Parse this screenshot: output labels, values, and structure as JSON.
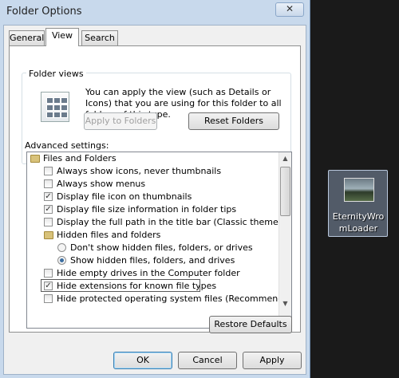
{
  "window": {
    "title": "Folder Options",
    "close_glyph": "✕"
  },
  "tabs": [
    {
      "label": "General"
    },
    {
      "label": "View"
    },
    {
      "label": "Search"
    }
  ],
  "folder_views": {
    "group_title": "Folder views",
    "icon": "folder-view-grid-icon",
    "description": "You can apply the view (such as Details or Icons) that you are using for this folder to all folders of this type.",
    "apply_label": "Apply to Folders",
    "reset_label": "Reset Folders"
  },
  "advanced": {
    "label": "Advanced settings:",
    "items": [
      {
        "text": "Files and Folders",
        "kind": "folder"
      },
      {
        "text": "Always show icons, never thumbnails",
        "kind": "checkbox",
        "checked": false
      },
      {
        "text": "Always show menus",
        "kind": "checkbox",
        "checked": false
      },
      {
        "text": "Display file icon on thumbnails",
        "kind": "checkbox",
        "checked": true
      },
      {
        "text": "Display file size information in folder tips",
        "kind": "checkbox",
        "checked": true
      },
      {
        "text": "Display the full path in the title bar (Classic theme only)",
        "kind": "checkbox",
        "checked": false
      },
      {
        "text": "Hidden files and folders",
        "kind": "folder"
      },
      {
        "text": "Don't show hidden files, folders, or drives",
        "kind": "radio",
        "checked": false
      },
      {
        "text": "Show hidden files, folders, and drives",
        "kind": "radio",
        "checked": true
      },
      {
        "text": "Hide empty drives in the Computer folder",
        "kind": "checkbox",
        "checked": false
      },
      {
        "text": "Hide extensions for known file types",
        "kind": "checkbox",
        "checked": true
      },
      {
        "text": "Hide protected operating system files (Recommended)",
        "kind": "checkbox",
        "checked": false
      }
    ],
    "check_glyph": "✓"
  },
  "restore_label": "Restore Defaults",
  "buttons": {
    "ok": "OK",
    "cancel": "Cancel",
    "apply": "Apply"
  },
  "desktop_icon": {
    "label": "EternityWromLoader",
    "icon": "image-file-icon"
  }
}
